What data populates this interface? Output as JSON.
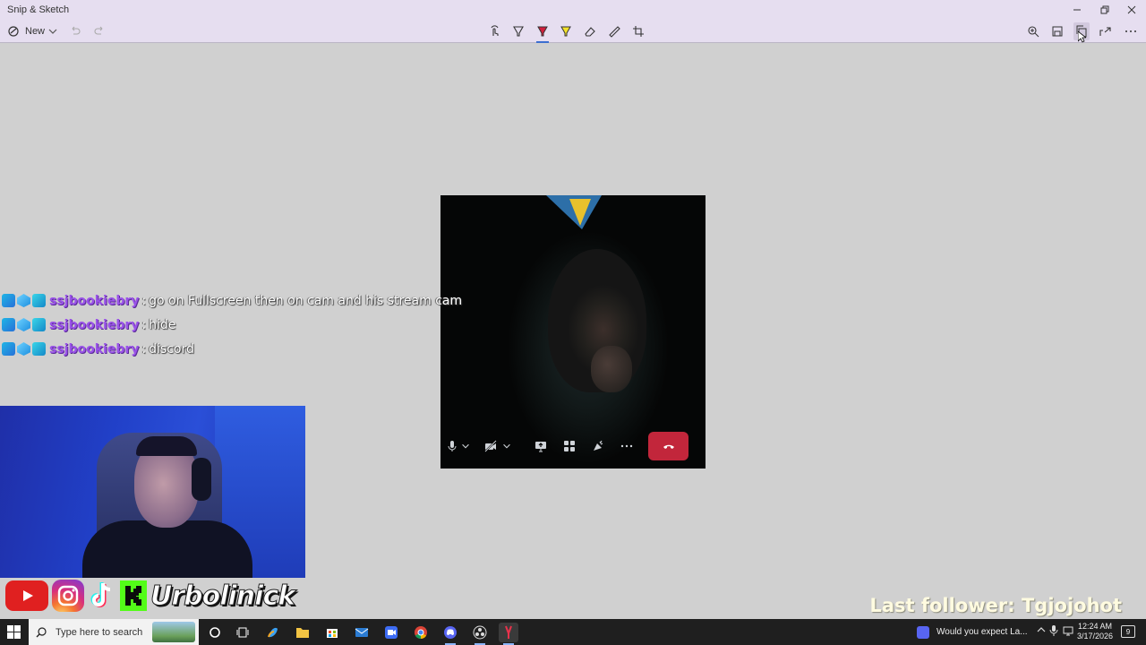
{
  "window": {
    "title": "Snip & Sketch",
    "controls": [
      "minimize",
      "restore",
      "close"
    ]
  },
  "toolbar": {
    "new_label": "New",
    "icons": [
      "new-snip-icon",
      "chevron-down-icon",
      "undo-icon",
      "redo-icon",
      "touch-writing-icon",
      "ballpoint-pen-icon",
      "pencil-icon",
      "highlighter-icon",
      "eraser-icon",
      "ruler-icon",
      "crop-icon",
      "zoom-icon",
      "save-icon",
      "copy-icon",
      "share-icon",
      "more-icon"
    ],
    "active_tool": "pencil"
  },
  "chat": {
    "messages": [
      {
        "user": "ssjbookiebry",
        "sep": ":",
        "text": "go on Fullscreen then on cam and his stream cam"
      },
      {
        "user": "ssjbookiebry",
        "sep": ":",
        "text": "hide"
      },
      {
        "user": "ssjbookiebry",
        "sep": ":",
        "text": "discord"
      }
    ]
  },
  "call": {
    "controls": [
      "microphone-icon",
      "camera-off-icon",
      "screen-share-icon",
      "activities-icon",
      "soundboard-icon",
      "more-icon",
      "hang-up-icon"
    ]
  },
  "overlay": {
    "handle": "Urbolinick",
    "socials": [
      "youtube-icon",
      "instagram-icon",
      "tiktok-icon",
      "kick-icon"
    ],
    "last_follower": "Last follower: Tgjojohot"
  },
  "taskbar": {
    "search_placeholder": "Type here to search",
    "notification": "Would you expect La...",
    "time": "12:24 AM",
    "date": "3/17/2026",
    "notification_count": "9"
  },
  "colors": {
    "accent": "#3c6fd0",
    "username": "#9a53e8",
    "hangup": "#c2263b",
    "follower_text": "#fffbe0"
  }
}
